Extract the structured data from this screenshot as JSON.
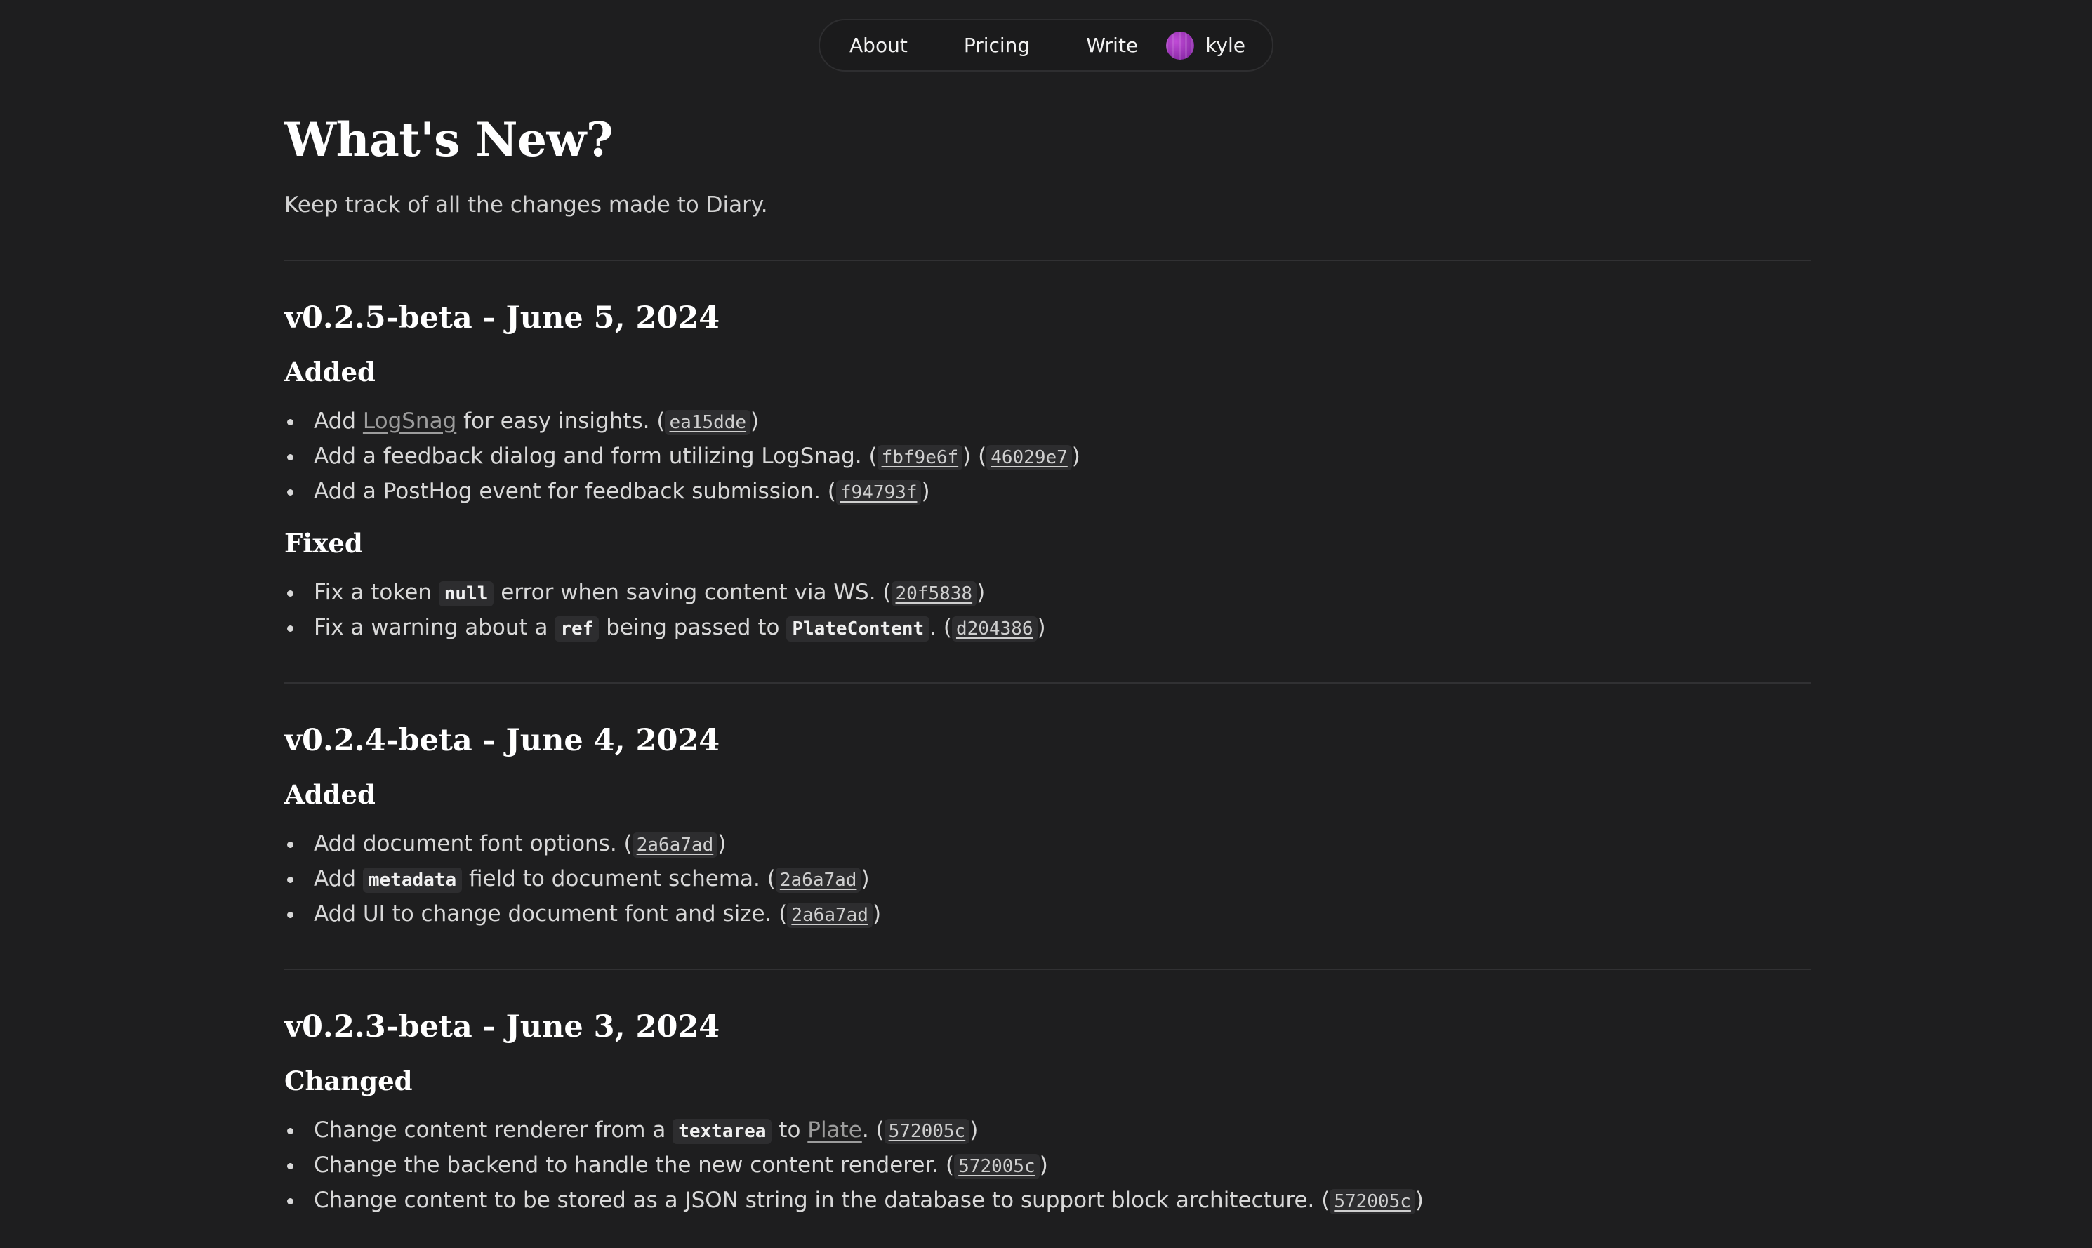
{
  "nav": {
    "about": "About",
    "pricing": "Pricing",
    "write": "Write",
    "user": "kyle",
    "avatar_color": "#a23bbf"
  },
  "page": {
    "title": "What's New?",
    "subtitle": "Keep track of all the changes made to Diary."
  },
  "releases": [
    {
      "heading": "v0.2.5-beta - June 5, 2024",
      "sections": [
        {
          "title": "Added",
          "items": [
            {
              "t1": "Add ",
              "link": "LogSnag",
              "t2": " for easy insights. (",
              "c1": "ea15dde",
              "t3": ")"
            },
            {
              "t1": "Add a feedback dialog and form utilizing LogSnag. (",
              "c1": "fbf9e6f",
              "t2": ") (",
              "c2": "46029e7",
              "t3": ")"
            },
            {
              "t1": "Add a PostHog event for feedback submission. (",
              "c1": "f94793f",
              "t2": ")"
            }
          ]
        },
        {
          "title": "Fixed",
          "items": [
            {
              "t1": "Fix a token ",
              "code1": "null",
              "t2": " error when saving content via WS. (",
              "c1": "20f5838",
              "t3": ")"
            },
            {
              "t1": "Fix a warning about a ",
              "code1": "ref",
              "t2": " being passed to ",
              "code2": "PlateContent",
              "t3": ". (",
              "c1": "d204386",
              "t4": ")"
            }
          ]
        }
      ]
    },
    {
      "heading": "v0.2.4-beta - June 4, 2024",
      "sections": [
        {
          "title": "Added",
          "items": [
            {
              "t1": "Add document font options. (",
              "c1": "2a6a7ad",
              "t2": ")"
            },
            {
              "t1": "Add ",
              "code1": "metadata",
              "t2": " field to document schema. (",
              "c1": "2a6a7ad",
              "t3": ")"
            },
            {
              "t1": "Add UI to change document font and size. (",
              "c1": "2a6a7ad",
              "t2": ")"
            }
          ]
        }
      ]
    },
    {
      "heading": "v0.2.3-beta - June 3, 2024",
      "sections": [
        {
          "title": "Changed",
          "items": [
            {
              "t1": "Change content renderer from a ",
              "code1": "textarea",
              "t2": " to ",
              "link": "Plate",
              "t3": ". (",
              "c1": "572005c",
              "t4": ")"
            },
            {
              "t1": "Change the backend to handle the new content renderer. (",
              "c1": "572005c",
              "t2": ")"
            },
            {
              "t1": "Change content to be stored as a JSON string in the database to support block architecture. (",
              "c1": "572005c",
              "t2": ")"
            }
          ]
        }
      ]
    }
  ]
}
